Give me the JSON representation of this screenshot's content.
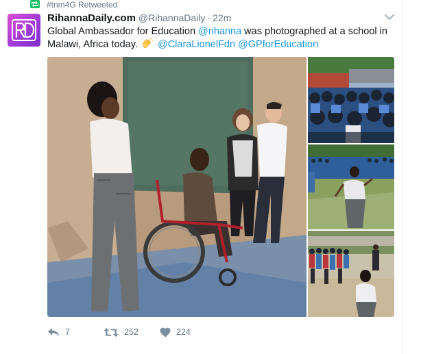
{
  "context": {
    "text": "#tnm4G Retweeted",
    "icon": "retweet-icon",
    "accent": "#17bf63"
  },
  "tweet": {
    "avatar_text": "RD",
    "display_name": "RihannaDaily.com",
    "handle": "@RihannaDaily",
    "separator": "·",
    "time": "22m",
    "text": {
      "part1": "Global Ambassador for Education ",
      "mention1": "@rihanna",
      "part2": " was photographed at a school in Malawi, Africa today.",
      "mention2": "@ClaraLionelFdn",
      "mention3": "@GPforEducation"
    },
    "emoji": "clapping-hands",
    "media_photos": 4
  },
  "actions": {
    "reply": {
      "icon": "reply-icon",
      "count": "7"
    },
    "retweet": {
      "icon": "retweet-icon",
      "count": "252"
    },
    "like": {
      "icon": "heart-icon",
      "count": "224"
    }
  },
  "colors": {
    "link": "#1b95e0",
    "secondary_text": "#657786",
    "primary_text": "#14171a"
  }
}
